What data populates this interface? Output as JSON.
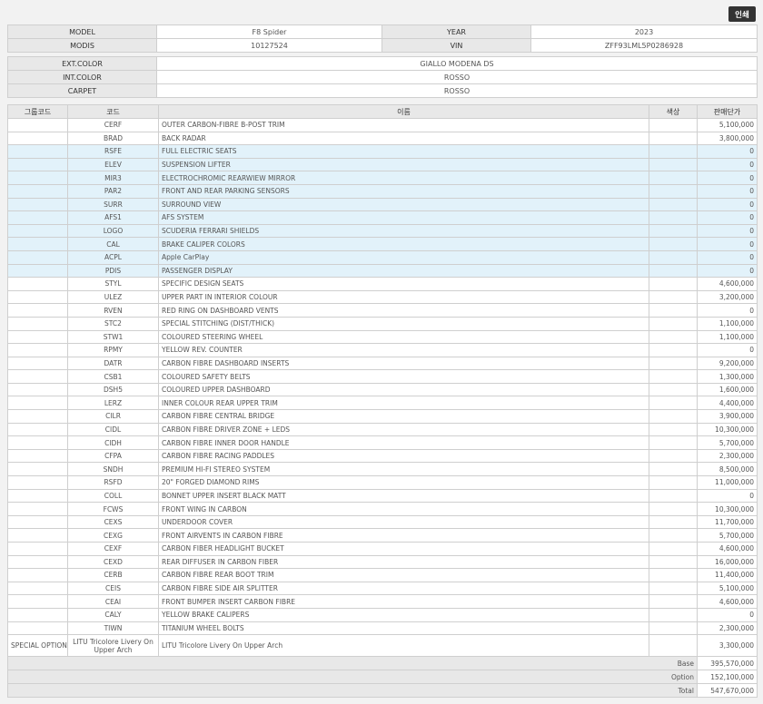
{
  "print_label": "인쇄",
  "vehicle": {
    "model_label": "MODEL",
    "model": "F8 Spider",
    "year_label": "YEAR",
    "year": "2023",
    "modis_label": "MODIS",
    "modis": "10127524",
    "vin_label": "VIN",
    "vin": "ZFF93LML5P0286928"
  },
  "colors": {
    "ext_label": "EXT.COLOR",
    "ext": "GIALLO MODENA DS",
    "int_label": "INT.COLOR",
    "int": "ROSSO",
    "carpet_label": "CARPET",
    "carpet": "ROSSO"
  },
  "options": {
    "headers": {
      "group": "그룹코드",
      "code": "코드",
      "name": "이름",
      "color": "색상",
      "price": "판매단가"
    },
    "rows": [
      {
        "group": "",
        "code": "CERF",
        "name": "OUTER CARBON-FIBRE B-POST TRIM",
        "color": "",
        "price": "5,100,000",
        "hl": false
      },
      {
        "group": "",
        "code": "BRAD",
        "name": "BACK RADAR",
        "color": "",
        "price": "3,800,000",
        "hl": false
      },
      {
        "group": "",
        "code": "RSFE",
        "name": "FULL ELECTRIC SEATS",
        "color": "",
        "price": "0",
        "hl": true
      },
      {
        "group": "",
        "code": "ELEV",
        "name": "SUSPENSION LIFTER",
        "color": "",
        "price": "0",
        "hl": true
      },
      {
        "group": "",
        "code": "MIR3",
        "name": "ELECTROCHROMIC REARWIEW MIRROR",
        "color": "",
        "price": "0",
        "hl": true
      },
      {
        "group": "",
        "code": "PAR2",
        "name": "FRONT AND REAR PARKING SENSORS",
        "color": "",
        "price": "0",
        "hl": true
      },
      {
        "group": "",
        "code": "SURR",
        "name": "SURROUND VIEW",
        "color": "",
        "price": "0",
        "hl": true
      },
      {
        "group": "",
        "code": "AFS1",
        "name": "AFS SYSTEM",
        "color": "",
        "price": "0",
        "hl": true
      },
      {
        "group": "",
        "code": "LOGO",
        "name": "SCUDERIA FERRARI SHIELDS",
        "color": "",
        "price": "0",
        "hl": true
      },
      {
        "group": "",
        "code": "CAL",
        "name": "BRAKE CALIPER COLORS",
        "color": "",
        "price": "0",
        "hl": true
      },
      {
        "group": "",
        "code": "ACPL",
        "name": "Apple CarPlay",
        "color": "",
        "price": "0",
        "hl": true
      },
      {
        "group": "",
        "code": "PDIS",
        "name": "PASSENGER DISPLAY",
        "color": "",
        "price": "0",
        "hl": true
      },
      {
        "group": "",
        "code": "STYL",
        "name": "SPECIFIC DESIGN SEATS",
        "color": "",
        "price": "4,600,000",
        "hl": false
      },
      {
        "group": "",
        "code": "ULEZ",
        "name": "UPPER PART IN INTERIOR COLOUR",
        "color": "",
        "price": "3,200,000",
        "hl": false
      },
      {
        "group": "",
        "code": "RVEN",
        "name": "RED RING ON DASHBOARD VENTS",
        "color": "",
        "price": "0",
        "hl": false
      },
      {
        "group": "",
        "code": "STC2",
        "name": "SPECIAL STITCHING (DIST/THICK)",
        "color": "",
        "price": "1,100,000",
        "hl": false
      },
      {
        "group": "",
        "code": "STW1",
        "name": "COLOURED STEERING WHEEL",
        "color": "",
        "price": "1,100,000",
        "hl": false
      },
      {
        "group": "",
        "code": "RPMY",
        "name": "YELLOW REV. COUNTER",
        "color": "",
        "price": "0",
        "hl": false
      },
      {
        "group": "",
        "code": "DATR",
        "name": "CARBON FIBRE DASHBOARD INSERTS",
        "color": "",
        "price": "9,200,000",
        "hl": false
      },
      {
        "group": "",
        "code": "CSB1",
        "name": "COLOURED SAFETY BELTS",
        "color": "",
        "price": "1,300,000",
        "hl": false
      },
      {
        "group": "",
        "code": "DSH5",
        "name": "COLOURED UPPER DASHBOARD",
        "color": "",
        "price": "1,600,000",
        "hl": false
      },
      {
        "group": "",
        "code": "LERZ",
        "name": "INNER COLOUR REAR UPPER TRIM",
        "color": "",
        "price": "4,400,000",
        "hl": false
      },
      {
        "group": "",
        "code": "CILR",
        "name": "CARBON FIBRE CENTRAL BRIDGE",
        "color": "",
        "price": "3,900,000",
        "hl": false
      },
      {
        "group": "",
        "code": "CIDL",
        "name": "CARBON FIBRE DRIVER ZONE + LEDS",
        "color": "",
        "price": "10,300,000",
        "hl": false
      },
      {
        "group": "",
        "code": "CIDH",
        "name": "CARBON FIBRE INNER DOOR HANDLE",
        "color": "",
        "price": "5,700,000",
        "hl": false
      },
      {
        "group": "",
        "code": "CFPA",
        "name": "CARBON FIBRE RACING PADDLES",
        "color": "",
        "price": "2,300,000",
        "hl": false
      },
      {
        "group": "",
        "code": "SNDH",
        "name": "PREMIUM HI-FI STEREO SYSTEM",
        "color": "",
        "price": "8,500,000",
        "hl": false
      },
      {
        "group": "",
        "code": "RSFD",
        "name": "20\" FORGED DIAMOND RIMS",
        "color": "",
        "price": "11,000,000",
        "hl": false
      },
      {
        "group": "",
        "code": "COLL",
        "name": "BONNET UPPER INSERT BLACK MATT",
        "color": "",
        "price": "0",
        "hl": false
      },
      {
        "group": "",
        "code": "FCWS",
        "name": "FRONT WING IN CARBON",
        "color": "",
        "price": "10,300,000",
        "hl": false
      },
      {
        "group": "",
        "code": "CEXS",
        "name": "UNDERDOOR COVER",
        "color": "",
        "price": "11,700,000",
        "hl": false
      },
      {
        "group": "",
        "code": "CEXG",
        "name": "FRONT AIRVENTS IN CARBON FIBRE",
        "color": "",
        "price": "5,700,000",
        "hl": false
      },
      {
        "group": "",
        "code": "CEXF",
        "name": "CARBON FIBER HEADLIGHT BUCKET",
        "color": "",
        "price": "4,600,000",
        "hl": false
      },
      {
        "group": "",
        "code": "CEXD",
        "name": "REAR DIFFUSER IN CARBON FIBER",
        "color": "",
        "price": "16,000,000",
        "hl": false
      },
      {
        "group": "",
        "code": "CERB",
        "name": "CARBON FIBRE REAR BOOT TRIM",
        "color": "",
        "price": "11,400,000",
        "hl": false
      },
      {
        "group": "",
        "code": "CEIS",
        "name": "CARBON FIBRE SIDE AIR SPLITTER",
        "color": "",
        "price": "5,100,000",
        "hl": false
      },
      {
        "group": "",
        "code": "CEAI",
        "name": "FRONT BUMPER INSERT CARBON FIBRE",
        "color": "",
        "price": "4,600,000",
        "hl": false
      },
      {
        "group": "",
        "code": "CALY",
        "name": "YELLOW BRAKE CALIPERS",
        "color": "",
        "price": "0",
        "hl": false
      },
      {
        "group": "",
        "code": "TIWN",
        "name": "TITANIUM WHEEL BOLTS",
        "color": "",
        "price": "2,300,000",
        "hl": false
      },
      {
        "group": "SPECIAL OPTION",
        "code": "LITU Tricolore Livery On Upper Arch",
        "name": "LITU Tricolore Livery On Upper Arch",
        "color": "",
        "price": "3,300,000",
        "hl": false,
        "tall": true
      }
    ],
    "totals": [
      {
        "label": "Base",
        "value": "395,570,000"
      },
      {
        "label": "Option",
        "value": "152,100,000"
      },
      {
        "label": "Total",
        "value": "547,670,000"
      }
    ]
  },
  "colors_theme": {
    "highlight": "#e2f2fa",
    "header_bg": "#e8e8e8",
    "button_bg": "#333333"
  }
}
